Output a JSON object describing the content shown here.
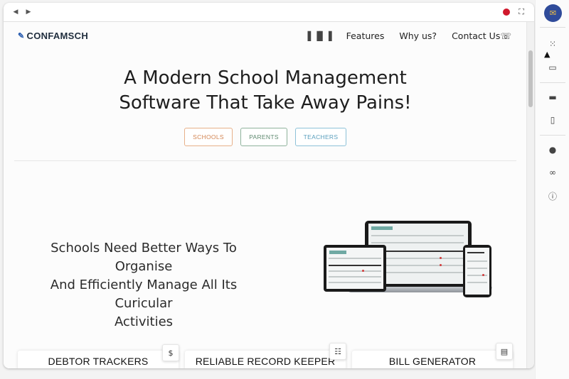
{
  "browser": {
    "back_icon": "chevron-left",
    "forward_icon": "chevron-right",
    "record_color": "#d0182c",
    "fullscreen_icon": "expand"
  },
  "nav": {
    "logo_text": "CONFAMSCH",
    "links": [
      "Features",
      "Why us?",
      "Contact Us"
    ]
  },
  "hero": {
    "title_line1": "A Modern School Management",
    "title_line2": "Software That Take Away Pains!",
    "tags": [
      "SCHOOLS",
      "PARENTS",
      "TEACHERS"
    ]
  },
  "tagline": {
    "line1": "Schools Need Better Ways To Organise",
    "line2": "And Efficiently Manage All Its Curicular",
    "line3": "Activities"
  },
  "cards": [
    "DEBTOR TRACKERS",
    "RELIABLE RECORD KEEPER",
    "BILL GENERATOR"
  ],
  "sidebar": {
    "icons": [
      "extension-icon",
      "dotted-select-icon",
      "screenshot-icon",
      "comment-icon",
      "add-file-icon",
      "github-icon",
      "link-icon",
      "info-icon"
    ]
  }
}
